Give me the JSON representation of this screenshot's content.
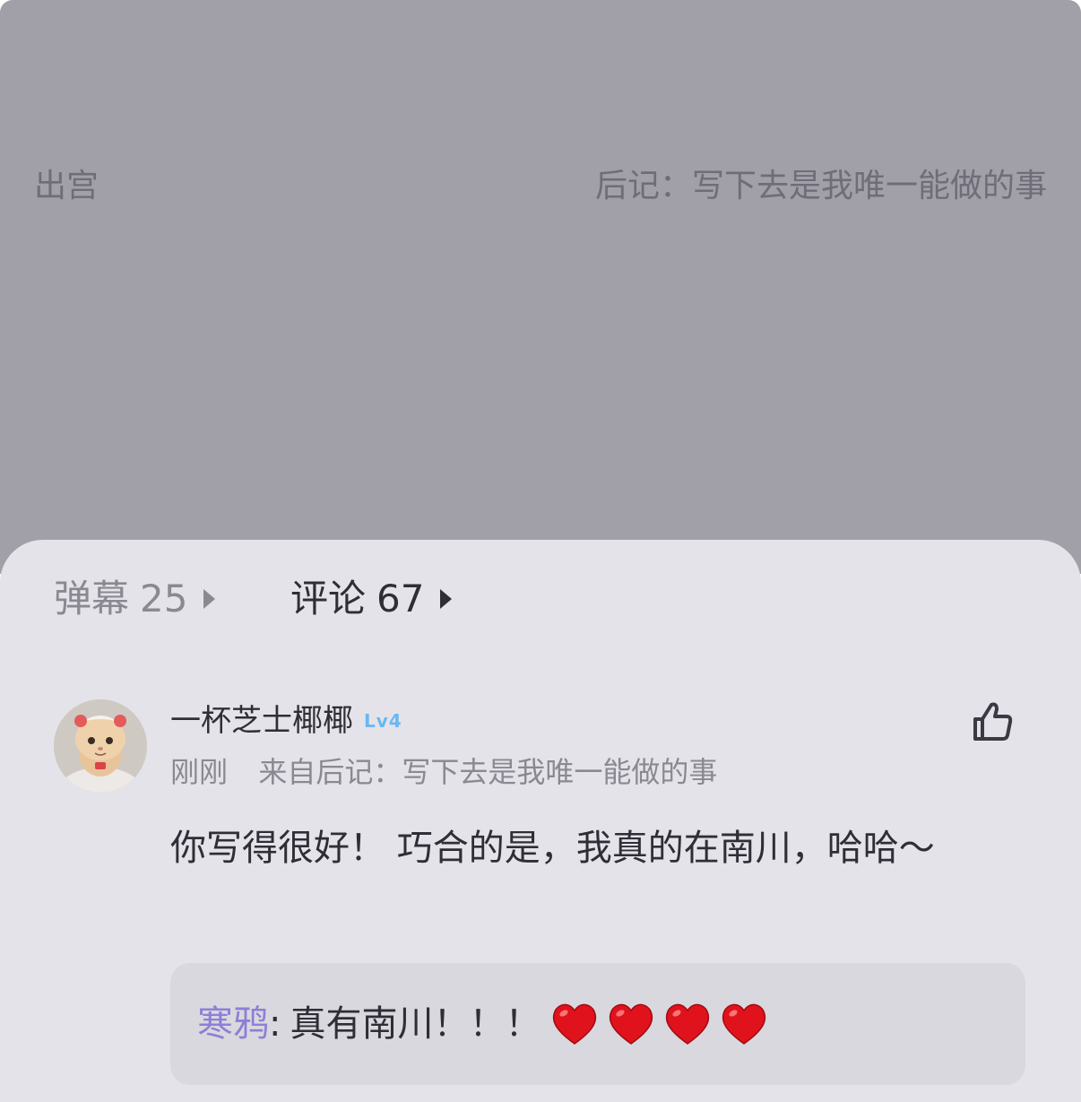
{
  "reader": {
    "prev_chapter": "出宫",
    "next_chapter": "后记：写下去是我唯一能做的事"
  },
  "tabs": {
    "danmaku": {
      "label": "弹幕",
      "count": "25"
    },
    "comments": {
      "label": "评论",
      "count": "67"
    }
  },
  "comment": {
    "username": "一杯芝士椰椰",
    "level": "Lv4",
    "time": "刚刚",
    "source": "来自后记：写下去是我唯一能做的事",
    "text": "你写得很好！  巧合的是，我真的在南川，哈哈～",
    "reply": {
      "author": "寒鸦",
      "separator": ":",
      "text": "真有南川！！！",
      "emoji_count": 4,
      "emoji": "red-heart"
    }
  },
  "colors": {
    "top_panel": "#a19fa8",
    "sheet": "#e4e3e9",
    "reply_author": "#8e7fd6",
    "level_badge": "#6ab7f2",
    "heart": "#e0121b"
  }
}
